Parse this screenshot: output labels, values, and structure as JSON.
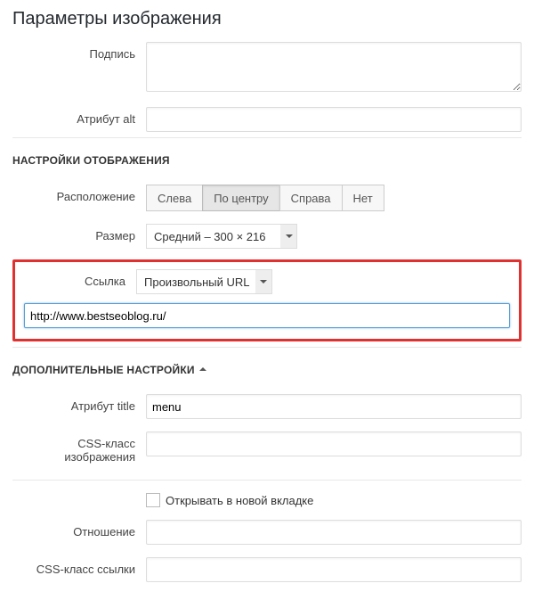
{
  "page_title": "Параметры изображения",
  "labels": {
    "caption": "Подпись",
    "alt": "Атрибут alt",
    "align": "Расположение",
    "size": "Размер",
    "link": "Ссылка",
    "title_attr": "Атрибут title",
    "css_image": "CSS-класс изображения",
    "new_tab": "Открывать в новой вкладке",
    "rel": "Отношение",
    "css_link": "CSS-класс ссылки"
  },
  "sections": {
    "display": "НАСТРОЙКИ ОТОБРАЖЕНИЯ",
    "advanced": "ДОПОЛНИТЕЛЬНЫЕ НАСТРОЙКИ"
  },
  "align": {
    "left": "Слева",
    "center": "По центру",
    "right": "Справа",
    "none": "Нет",
    "active": "center"
  },
  "size": {
    "selected": "Средний – 300 × 216"
  },
  "link": {
    "type_selected": "Произвольный URL",
    "url": "http://www.bestseoblog.ru/"
  },
  "values": {
    "caption": "",
    "alt": "",
    "title_attr": "menu",
    "css_image": "",
    "rel": "",
    "css_link": ""
  }
}
